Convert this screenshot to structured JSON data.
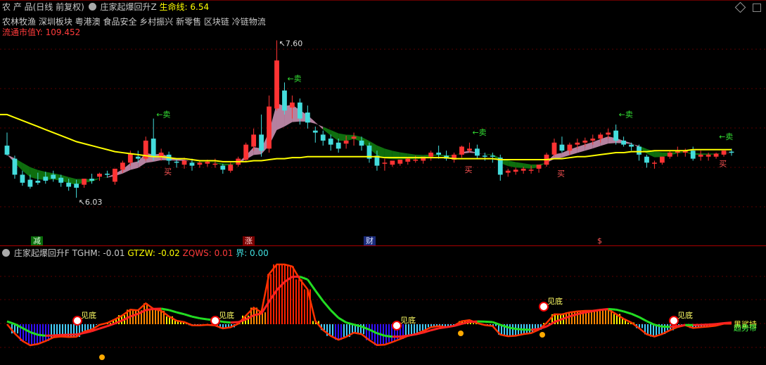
{
  "header": {
    "product": "农 产 品(日线 前复权)",
    "indicator_name": "庄家起爆回升Z",
    "lifeline_label": "生命线: 6.54",
    "concepts": "农林牧渔 深圳板块 粤港澳 食品安全 乡村振兴 新零售 区块链 冷链物流",
    "float_value_label": "流通市值Y:",
    "float_value": "109.452",
    "diamond_icon": "diamond-icon",
    "checkbox_icon": "checkbox-icon"
  },
  "sub_header": {
    "name": "庄家起爆回升F",
    "tghm": "TGHM: -0.01",
    "gtzw": "GTZW: -0.02",
    "zqws": "ZQWS: 0.01",
    "jie": "界: 0.00"
  },
  "markers": {
    "jian": "减",
    "zhang": "涨",
    "cai": "财",
    "s": "$"
  },
  "annotations": {
    "high": "7.60",
    "low": "6.03",
    "sell": "←卖",
    "buy": "买",
    "bottom_signal": "见底",
    "right_a": "黑鲨持",
    "right_b": "趋势带"
  },
  "colors": {
    "up": "#ff3333",
    "down": "#44dddd",
    "lifeline": "#ffff00",
    "band_green": "#0f7a0f",
    "band_pink": "#c98fb0"
  },
  "chart_data": {
    "type": "candlestick",
    "ylim": [
      5.8,
      7.75
    ],
    "candles": [
      [
        6.55,
        6.68,
        6.46,
        6.45
      ],
      [
        6.42,
        6.45,
        6.26,
        6.22
      ],
      [
        6.26,
        6.3,
        6.18,
        6.15
      ],
      [
        6.21,
        6.26,
        6.14,
        6.12
      ],
      [
        6.2,
        6.28,
        6.18,
        6.16
      ],
      [
        6.24,
        6.29,
        6.2,
        6.17
      ],
      [
        6.26,
        6.3,
        6.22,
        6.19
      ],
      [
        6.23,
        6.26,
        6.18,
        6.14
      ],
      [
        6.18,
        6.22,
        6.14,
        6.1
      ],
      [
        6.17,
        6.21,
        6.13,
        6.03
      ],
      [
        6.16,
        6.22,
        6.22,
        6.13
      ],
      [
        6.22,
        6.27,
        6.2,
        6.17
      ],
      [
        6.24,
        6.28,
        6.27,
        6.2
      ],
      [
        6.27,
        6.3,
        6.26,
        6.23
      ],
      [
        6.19,
        6.3,
        6.32,
        6.16
      ],
      [
        6.31,
        6.4,
        6.38,
        6.28
      ],
      [
        6.38,
        6.5,
        6.47,
        6.35
      ],
      [
        6.44,
        6.5,
        6.42,
        6.38
      ],
      [
        6.42,
        6.64,
        6.6,
        6.4
      ],
      [
        6.62,
        6.82,
        6.44,
        6.4
      ],
      [
        6.43,
        6.52,
        6.48,
        6.4
      ],
      [
        6.46,
        6.49,
        6.4,
        6.36
      ],
      [
        6.39,
        6.42,
        6.38,
        6.33
      ],
      [
        6.36,
        6.43,
        6.4,
        6.32
      ],
      [
        6.38,
        6.42,
        6.35,
        6.3
      ],
      [
        6.36,
        6.4,
        6.38,
        6.33
      ],
      [
        6.37,
        6.41,
        6.39,
        6.34
      ],
      [
        6.36,
        6.42,
        6.37,
        6.33
      ],
      [
        6.35,
        6.37,
        6.31,
        6.27
      ],
      [
        6.3,
        6.38,
        6.36,
        6.28
      ],
      [
        6.36,
        6.44,
        6.42,
        6.34
      ],
      [
        6.41,
        6.58,
        6.56,
        6.39
      ],
      [
        6.54,
        6.72,
        6.66,
        6.5
      ],
      [
        6.66,
        6.86,
        6.5,
        6.44
      ],
      [
        6.52,
        7.05,
        6.94,
        6.48
      ],
      [
        6.92,
        7.6,
        7.4,
        6.9
      ],
      [
        7.1,
        7.18,
        6.9,
        6.86
      ],
      [
        6.93,
        7.05,
        6.98,
        6.82
      ],
      [
        6.98,
        7.02,
        6.82,
        6.76
      ],
      [
        6.88,
        6.95,
        6.78,
        6.72
      ],
      [
        6.7,
        6.74,
        6.68,
        6.58
      ],
      [
        6.66,
        6.7,
        6.6,
        6.55
      ],
      [
        6.62,
        6.66,
        6.56,
        6.5
      ],
      [
        6.58,
        6.62,
        6.52,
        6.48
      ],
      [
        6.57,
        6.65,
        6.6,
        6.52
      ],
      [
        6.62,
        6.68,
        6.64,
        6.55
      ],
      [
        6.6,
        6.64,
        6.55,
        6.5
      ],
      [
        6.55,
        6.58,
        6.42,
        6.38
      ],
      [
        6.45,
        6.5,
        6.35,
        6.3
      ],
      [
        6.38,
        6.42,
        6.38,
        6.3
      ],
      [
        6.36,
        6.39,
        6.4,
        6.34
      ],
      [
        6.37,
        6.4,
        6.41,
        6.35
      ],
      [
        6.39,
        6.43,
        6.42,
        6.36
      ],
      [
        6.41,
        6.45,
        6.41,
        6.38
      ],
      [
        6.4,
        6.44,
        6.44,
        6.37
      ],
      [
        6.44,
        6.5,
        6.48,
        6.4
      ],
      [
        6.48,
        6.55,
        6.46,
        6.42
      ],
      [
        6.45,
        6.5,
        6.42,
        6.4
      ],
      [
        6.41,
        6.48,
        6.46,
        6.38
      ],
      [
        6.46,
        6.55,
        6.54,
        6.43
      ],
      [
        6.5,
        6.58,
        6.52,
        6.48
      ],
      [
        6.52,
        6.56,
        6.45,
        6.42
      ],
      [
        6.45,
        6.48,
        6.44,
        6.4
      ],
      [
        6.45,
        6.48,
        6.44,
        6.38
      ],
      [
        6.43,
        6.46,
        6.26,
        6.2
      ],
      [
        6.28,
        6.32,
        6.3,
        6.24
      ],
      [
        6.29,
        6.33,
        6.31,
        6.26
      ],
      [
        6.3,
        6.34,
        6.32,
        6.27
      ],
      [
        6.31,
        6.35,
        6.31,
        6.27
      ],
      [
        6.32,
        6.36,
        6.36,
        6.28
      ],
      [
        6.36,
        6.48,
        6.46,
        6.34
      ],
      [
        6.46,
        6.62,
        6.58,
        6.44
      ],
      [
        6.56,
        6.64,
        6.5,
        6.48
      ],
      [
        6.5,
        6.58,
        6.56,
        6.46
      ],
      [
        6.56,
        6.62,
        6.58,
        6.52
      ],
      [
        6.58,
        6.63,
        6.6,
        6.54
      ],
      [
        6.6,
        6.66,
        6.62,
        6.56
      ],
      [
        6.62,
        6.68,
        6.66,
        6.58
      ],
      [
        6.66,
        6.72,
        6.68,
        6.62
      ],
      [
        6.7,
        6.76,
        6.6,
        6.56
      ],
      [
        6.6,
        6.64,
        6.56,
        6.54
      ],
      [
        6.56,
        6.58,
        6.54,
        6.5
      ],
      [
        6.54,
        6.56,
        6.46,
        6.4
      ],
      [
        6.44,
        6.46,
        6.38,
        6.33
      ],
      [
        6.38,
        6.4,
        6.38,
        6.32
      ],
      [
        6.38,
        6.44,
        6.44,
        6.36
      ],
      [
        6.44,
        6.5,
        6.48,
        6.42
      ],
      [
        6.48,
        6.54,
        6.5,
        6.44
      ],
      [
        6.48,
        6.52,
        6.5,
        6.44
      ],
      [
        6.5,
        6.54,
        6.42,
        6.4
      ],
      [
        6.44,
        6.5,
        6.46,
        6.4
      ],
      [
        6.44,
        6.48,
        6.46,
        6.4
      ],
      [
        6.44,
        6.48,
        6.47,
        6.42
      ],
      [
        6.46,
        6.5,
        6.5,
        6.44
      ],
      [
        6.49,
        6.52,
        6.48,
        6.45
      ]
    ],
    "lifeline": [
      6.86,
      6.83,
      6.8,
      6.77,
      6.74,
      6.71,
      6.68,
      6.65,
      6.62,
      6.59,
      6.57,
      6.55,
      6.53,
      6.51,
      6.49,
      6.48,
      6.47,
      6.46,
      6.45,
      6.44,
      6.44,
      6.43,
      6.42,
      6.42,
      6.41,
      6.4,
      6.4,
      6.4,
      6.39,
      6.39,
      6.39,
      6.39,
      6.4,
      6.4,
      6.41,
      6.42,
      6.42,
      6.43,
      6.43,
      6.44,
      6.44,
      6.44,
      6.44,
      6.44,
      6.44,
      6.44,
      6.44,
      6.44,
      6.44,
      6.43,
      6.43,
      6.43,
      6.43,
      6.43,
      6.43,
      6.43,
      6.43,
      6.43,
      6.42,
      6.42,
      6.42,
      6.42,
      6.42,
      6.42,
      6.41,
      6.41,
      6.41,
      6.41,
      6.41,
      6.41,
      6.41,
      6.42,
      6.42,
      6.43,
      6.44,
      6.44,
      6.45,
      6.46,
      6.47,
      6.48,
      6.48,
      6.49,
      6.49,
      6.49,
      6.5,
      6.5,
      6.5,
      6.5,
      6.5,
      6.51,
      6.51,
      6.51,
      6.51,
      6.51,
      6.51
    ]
  }
}
